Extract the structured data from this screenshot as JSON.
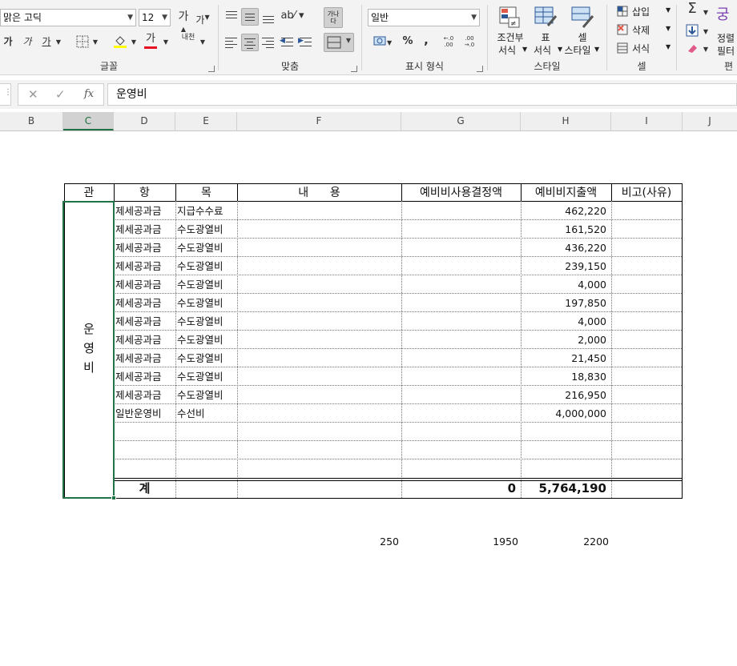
{
  "ribbon": {
    "font": {
      "name": "맑은 고딕",
      "size": "12",
      "grow_label": "가",
      "shrink_label": "가",
      "bold": "가",
      "italic": "가",
      "underline": "가",
      "fill_label": "가",
      "color_label": "가",
      "phonetic_label": "내천",
      "group_label": "글꼴"
    },
    "alignment": {
      "wrap_label": "가나다",
      "group_label": "맞춤"
    },
    "number": {
      "format": "일반",
      "percent": "%",
      "comma": ",",
      "inc_decimal": "←.0 .00",
      "dec_decimal": ".00 →.0",
      "group_label": "표시 형식"
    },
    "styles": {
      "conditional_line1": "조건부",
      "conditional_line2": "서식",
      "table_line1": "표",
      "table_line2": "서식",
      "cell_line1": "셀",
      "cell_line2": "스타일",
      "group_label": "스타일"
    },
    "cells": {
      "insert": "삽입",
      "delete": "삭제",
      "format": "서식",
      "group_label": "셀"
    },
    "editing": {
      "sort_line1": "정렬",
      "sort_line2": "필터",
      "group_label": "편"
    },
    "colors": {
      "highlight": "#ffff00",
      "font_red": "#e81123",
      "accent": "#217346"
    }
  },
  "formula_bar": {
    "cancel_icon": "✕",
    "enter_icon": "✓",
    "fx_label": "fx",
    "value": "운영비"
  },
  "columns": [
    {
      "name": "B",
      "selected": false
    },
    {
      "name": "C",
      "selected": true
    },
    {
      "name": "D",
      "selected": false
    },
    {
      "name": "E",
      "selected": false
    },
    {
      "name": "F",
      "selected": false
    },
    {
      "name": "G",
      "selected": false
    },
    {
      "name": "H",
      "selected": false
    },
    {
      "name": "I",
      "selected": false
    },
    {
      "name": "J",
      "selected": false
    }
  ],
  "table": {
    "headers": {
      "gwan": "관",
      "hang": "항",
      "mok": "목",
      "content": "내      용",
      "reserve_decision": "예비비사용결정액",
      "reserve_spent": "예비비지출액",
      "remark": "비고(사유)"
    },
    "gwan_value": "운\n영\n비",
    "rows": [
      {
        "hang": "제세공과금",
        "mok": "지급수수료",
        "amount": "462,220"
      },
      {
        "hang": "제세공과금",
        "mok": "수도광열비",
        "amount": "161,520"
      },
      {
        "hang": "제세공과금",
        "mok": "수도광열비",
        "amount": "436,220"
      },
      {
        "hang": "제세공과금",
        "mok": "수도광열비",
        "amount": "239,150"
      },
      {
        "hang": "제세공과금",
        "mok": "수도광열비",
        "amount": "4,000"
      },
      {
        "hang": "제세공과금",
        "mok": "수도광열비",
        "amount": "197,850"
      },
      {
        "hang": "제세공과금",
        "mok": "수도광열비",
        "amount": "4,000"
      },
      {
        "hang": "제세공과금",
        "mok": "수도광열비",
        "amount": "2,000"
      },
      {
        "hang": "제세공과금",
        "mok": "수도광열비",
        "amount": "21,450"
      },
      {
        "hang": "제세공과금",
        "mok": "수도광열비",
        "amount": "18,830"
      },
      {
        "hang": "제세공과금",
        "mok": "수도광열비",
        "amount": "216,950"
      },
      {
        "hang": "일반운영비",
        "mok": "수선비",
        "amount": "4,000,000"
      },
      {
        "hang": "",
        "mok": "",
        "amount": ""
      },
      {
        "hang": "",
        "mok": "",
        "amount": ""
      },
      {
        "hang": "",
        "mok": "",
        "amount": ""
      }
    ],
    "total": {
      "label": "계",
      "decision": "0",
      "spent": "5,764,190"
    }
  },
  "below_table": {
    "g": "250",
    "h": "1950",
    "i": "2200"
  }
}
